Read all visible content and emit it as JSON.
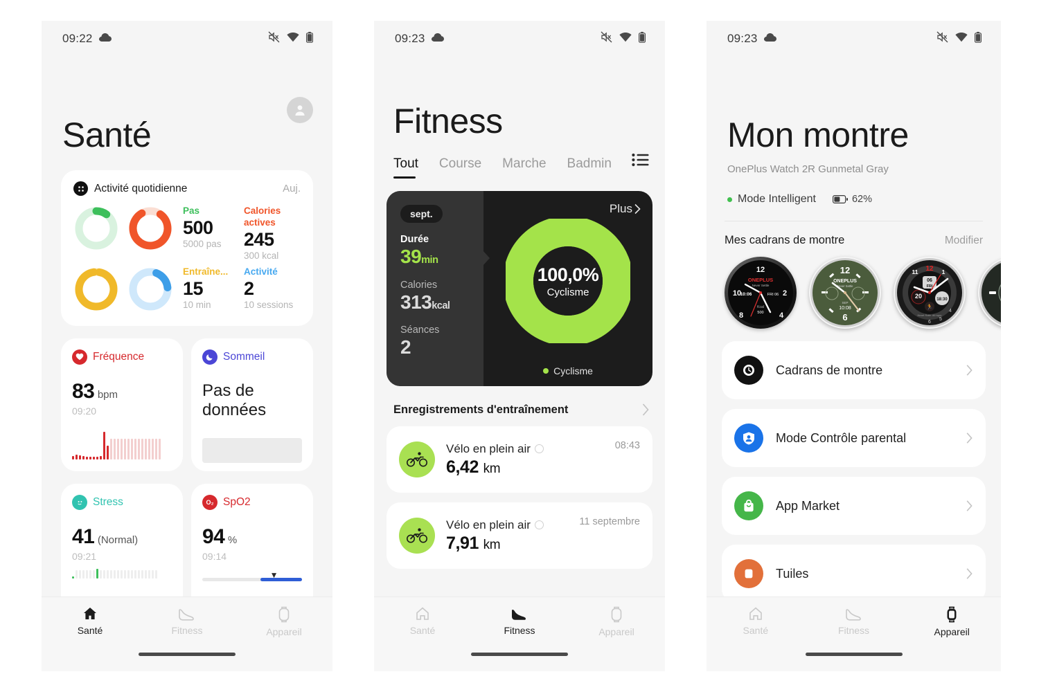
{
  "colors": {
    "app_bg": "#f5f5f5",
    "accent_green": "#a4e34a",
    "steps_green": "#3dbf5b",
    "calories_orange": "#f0552a",
    "training_yellow": "#f0b92a",
    "activity_blue": "#47a9f0",
    "heart_red": "#d6292d",
    "sleep_purple": "#4b46d6",
    "stress_teal": "#31c3b0",
    "spo2_red": "#d6292d",
    "market_green": "#45b649",
    "parental_blue": "#1a73e8",
    "tiles_orange": "#e2703a"
  },
  "phone1": {
    "status": {
      "time": "09:22",
      "weather_icon": "cloud-icon",
      "mute_icon": "mute-icon",
      "wifi_icon": "wifi-icon",
      "battery_icon": "battery-icon"
    },
    "title": "Santé",
    "avatar_icon": "account-avatar-icon",
    "activity_card": {
      "icon": "daily-activity-icon",
      "title": "Activité quotidienne",
      "period": "Auj.",
      "metrics": [
        {
          "label": "Pas",
          "value": "500",
          "sub": "5000 pas",
          "color": "#3dbf5b",
          "ring_pct": 10,
          "ring_color": "#3dbf5b",
          "ring_track": "#d9f2df"
        },
        {
          "label": "Calories actives",
          "value": "245",
          "sub": "300 kcal",
          "color": "#f0552a",
          "ring_pct": 82,
          "ring_color": "#f0552a",
          "ring_track": "#fbded3"
        },
        {
          "label": "Entraîne...",
          "value": "15",
          "sub": "10 min",
          "color": "#f0b92a",
          "ring_pct": 95,
          "ring_color": "#f0b92a",
          "ring_track": "#f8e7b4"
        },
        {
          "label": "Activité",
          "value": "2",
          "sub": "10 sessions",
          "color": "#47a9f0",
          "ring_pct": 18,
          "ring_color": "#3d9ee8",
          "ring_track": "#cfe8fb"
        }
      ]
    },
    "cards": [
      {
        "name": "Fréquence",
        "icon": "heart-icon",
        "color": "#d6292d",
        "value": "83",
        "unit": "bpm",
        "time": "09:20",
        "chart": "heart-sparkline"
      },
      {
        "name": "Sommeil",
        "icon": "moon-icon",
        "color": "#4b46d6",
        "nodata": "Pas de données",
        "chart": "placeholder-block"
      },
      {
        "name": "Stress",
        "icon": "stress-face-icon",
        "color": "#31c3b0",
        "value": "41",
        "unit": "(Normal)",
        "time": "09:21",
        "chart": "stress-bars"
      },
      {
        "name": "SpO2",
        "icon": "spo2-icon",
        "color": "#d6292d",
        "value": "94",
        "unit": "%",
        "time": "09:14",
        "chart": "spo2-range"
      }
    ],
    "nav": [
      {
        "label": "Santé",
        "icon": "home-icon",
        "active": true
      },
      {
        "label": "Fitness",
        "icon": "shoe-icon",
        "active": false
      },
      {
        "label": "Appareil",
        "icon": "watch-icon",
        "active": false
      }
    ]
  },
  "phone2": {
    "status": {
      "time": "09:23",
      "weather_icon": "cloud-icon",
      "mute_icon": "mute-icon",
      "wifi_icon": "wifi-icon",
      "battery_icon": "battery-icon"
    },
    "title": "Fitness",
    "tabs": [
      {
        "label": "Tout",
        "active": true
      },
      {
        "label": "Course",
        "active": false
      },
      {
        "label": "Marche",
        "active": false
      },
      {
        "label": "Badminton",
        "active": false
      }
    ],
    "tab_list_icon": "list-view-icon",
    "summary": {
      "month": "sept.",
      "more_label": "Plus",
      "more_icon": "chevron-right-icon",
      "duration_label": "Durée",
      "duration_value": "39",
      "duration_unit": "min",
      "calories_label": "Calories",
      "calories_value": "313",
      "calories_unit": "kcal",
      "sessions_label": "Séances",
      "sessions_value": "2",
      "donut_pct": "100,0%",
      "donut_label": "Cyclisme",
      "legend_label": "Cyclisme"
    },
    "records_header": "Enregistrements d'entraînement",
    "records_chevron": "chevron-right-icon",
    "records": [
      {
        "icon": "cycling-icon",
        "name": "Vélo en plein air",
        "sync_icon": "sync-cloud-icon",
        "distance": "6,42",
        "unit": "km",
        "time": "08:43"
      },
      {
        "icon": "cycling-icon",
        "name": "Vélo en plein air",
        "sync_icon": "sync-cloud-icon",
        "distance": "7,91",
        "unit": "km",
        "time": "11 septembre"
      }
    ],
    "nav": [
      {
        "label": "Santé",
        "icon": "home-icon",
        "active": false
      },
      {
        "label": "Fitness",
        "icon": "shoe-icon",
        "active": true
      },
      {
        "label": "Appareil",
        "icon": "watch-icon",
        "active": false
      }
    ]
  },
  "phone3": {
    "status": {
      "time": "09:23",
      "weather_icon": "cloud-icon",
      "mute_icon": "mute-icon",
      "wifi_icon": "wifi-icon",
      "battery_icon": "battery-icon"
    },
    "title": "Mon montre",
    "device_name": "OnePlus Watch 2R Gunmetal Gray",
    "mode_label": "Mode Intelligent",
    "battery_percent": "62%",
    "battery_icon": "battery-half-icon",
    "faces_title": "Mes cadrans de montre",
    "faces_edit": "Modifier",
    "faces": [
      {
        "name": "watch-face-oneplus-black",
        "brand": "ONEPLUS",
        "tagline": "Never Settle",
        "top": "12",
        "left": "10",
        "right": "2",
        "bottom": "8",
        "bottom2": "4",
        "sub_time": "10:06",
        "sub_day": "FRI",
        "sub_date": "06",
        "kcal_label": "Kcal",
        "kcal_value": "500"
      },
      {
        "name": "watch-face-oneplus-green",
        "brand": "ONEPLUS",
        "tagline": "Never Settle",
        "top": "12",
        "bottom": "6",
        "sub_time": "10:08"
      },
      {
        "name": "watch-face-red-sport",
        "top": "12",
        "sub_date": "06",
        "sub_day": "FRI",
        "left": "20",
        "sub_time": "18:30",
        "hr_text": "Heart Rate: 86 bpm"
      },
      {
        "name": "watch-face-dark-partial"
      }
    ],
    "menu": [
      {
        "label": "Cadrans de montre",
        "icon": "watch-face-clock-icon",
        "color": "#111111",
        "chevron": "chevron-right-icon"
      },
      {
        "label": "Mode Contrôle parental",
        "icon": "parental-control-icon",
        "color": "#1a73e8",
        "chevron": "chevron-right-icon"
      },
      {
        "label": "App Market",
        "icon": "app-market-bag-icon",
        "color": "#45b649",
        "chevron": "chevron-right-icon"
      },
      {
        "label": "Tuiles",
        "icon": "tiles-icon",
        "color": "#e2703a",
        "chevron": "chevron-right-icon"
      }
    ],
    "nav": [
      {
        "label": "Santé",
        "icon": "home-icon",
        "active": false
      },
      {
        "label": "Fitness",
        "icon": "shoe-icon",
        "active": false
      },
      {
        "label": "Appareil",
        "icon": "watch-icon",
        "active": true
      }
    ]
  }
}
